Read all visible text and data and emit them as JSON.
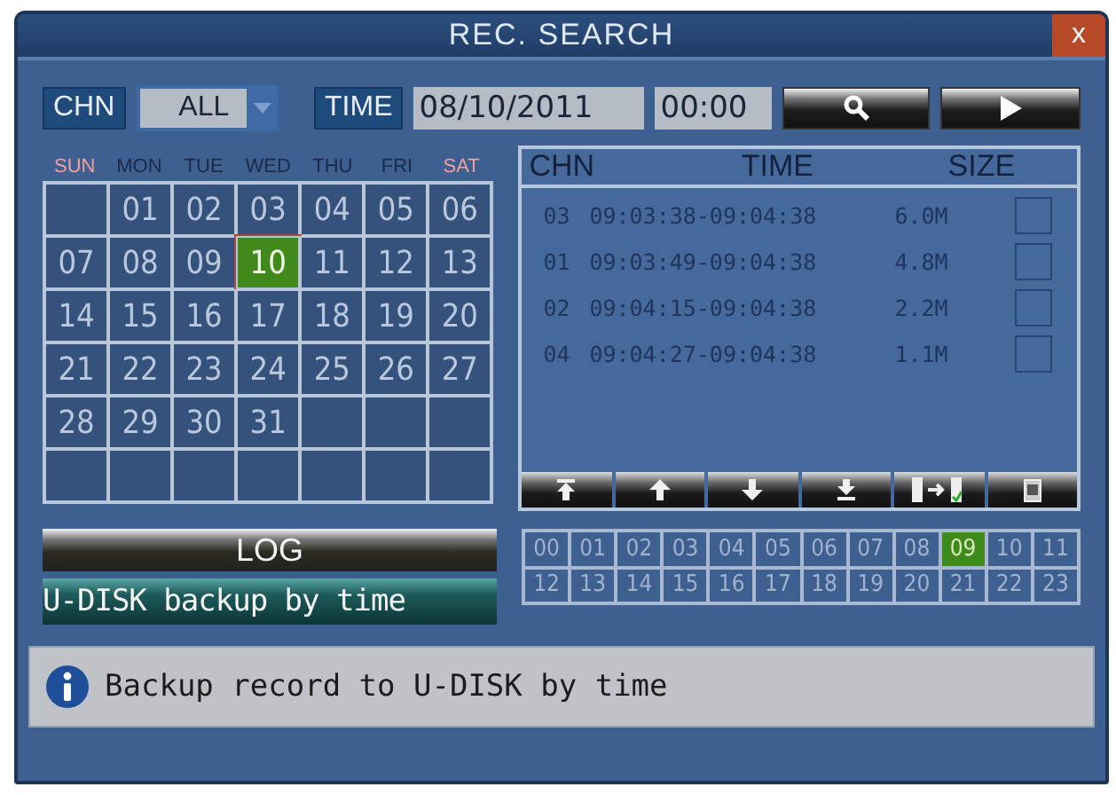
{
  "window": {
    "title": "REC. SEARCH",
    "close": "x"
  },
  "toolbar": {
    "channel_label": "CHN",
    "channel_value": "ALL",
    "time_label": "TIME",
    "date": "08/10/2011",
    "time": "00:00"
  },
  "calendar": {
    "weekdays": [
      {
        "label": "SUN",
        "weekend": true
      },
      {
        "label": "MON",
        "weekend": false
      },
      {
        "label": "TUE",
        "weekend": false
      },
      {
        "label": "WED",
        "weekend": false
      },
      {
        "label": "THU",
        "weekend": false
      },
      {
        "label": "FRI",
        "weekend": false
      },
      {
        "label": "SAT",
        "weekend": true
      }
    ],
    "weeks": [
      [
        {
          "kind": "blank"
        },
        {
          "kind": "day",
          "day": "01",
          "selected": false
        },
        {
          "kind": "day",
          "day": "02",
          "selected": false
        },
        {
          "kind": "day",
          "day": "03",
          "selected": false
        },
        {
          "kind": "day",
          "day": "04",
          "selected": false
        },
        {
          "kind": "day",
          "day": "05",
          "selected": false
        },
        {
          "kind": "day",
          "day": "06",
          "selected": false
        }
      ],
      [
        {
          "kind": "day",
          "day": "07",
          "selected": false
        },
        {
          "kind": "day",
          "day": "08",
          "selected": false
        },
        {
          "kind": "day",
          "day": "09",
          "selected": false
        },
        {
          "kind": "day",
          "day": "10",
          "selected": true
        },
        {
          "kind": "day",
          "day": "11",
          "selected": false
        },
        {
          "kind": "day",
          "day": "12",
          "selected": false
        },
        {
          "kind": "day",
          "day": "13",
          "selected": false
        }
      ],
      [
        {
          "kind": "day",
          "day": "14",
          "selected": false
        },
        {
          "kind": "day",
          "day": "15",
          "selected": false
        },
        {
          "kind": "day",
          "day": "16",
          "selected": false
        },
        {
          "kind": "day",
          "day": "17",
          "selected": false
        },
        {
          "kind": "day",
          "day": "18",
          "selected": false
        },
        {
          "kind": "day",
          "day": "19",
          "selected": false
        },
        {
          "kind": "day",
          "day": "20",
          "selected": false
        }
      ],
      [
        {
          "kind": "day",
          "day": "21",
          "selected": false
        },
        {
          "kind": "day",
          "day": "22",
          "selected": false
        },
        {
          "kind": "day",
          "day": "23",
          "selected": false
        },
        {
          "kind": "day",
          "day": "24",
          "selected": false
        },
        {
          "kind": "day",
          "day": "25",
          "selected": false
        },
        {
          "kind": "day",
          "day": "26",
          "selected": false
        },
        {
          "kind": "day",
          "day": "27",
          "selected": false
        }
      ],
      [
        {
          "kind": "day",
          "day": "28",
          "selected": false
        },
        {
          "kind": "day",
          "day": "29",
          "selected": false
        },
        {
          "kind": "day",
          "day": "30",
          "selected": false
        },
        {
          "kind": "day",
          "day": "31",
          "selected": false
        },
        {
          "kind": "blank"
        },
        {
          "kind": "blank"
        },
        {
          "kind": "blank"
        }
      ],
      [
        {
          "kind": "blank"
        },
        {
          "kind": "blank"
        },
        {
          "kind": "blank"
        },
        {
          "kind": "blank"
        },
        {
          "kind": "blank"
        },
        {
          "kind": "blank"
        },
        {
          "kind": "blank"
        }
      ]
    ]
  },
  "records": {
    "columns": [
      "CHN",
      "TIME",
      "SIZE"
    ],
    "rows": [
      {
        "chn": "03",
        "time": "09:03:38-09:04:38",
        "size": "6.0M",
        "checked": false
      },
      {
        "chn": "01",
        "time": "09:03:49-09:04:38",
        "size": "4.8M",
        "checked": false
      },
      {
        "chn": "02",
        "time": "09:04:15-09:04:38",
        "size": "2.2M",
        "checked": false
      },
      {
        "chn": "04",
        "time": "09:04:27-09:04:38",
        "size": "1.1M",
        "checked": false
      }
    ]
  },
  "log_button": "LOG",
  "backup_option": "U-DISK backup by time",
  "hours": [
    {
      "label": "00",
      "selected": false
    },
    {
      "label": "01",
      "selected": false
    },
    {
      "label": "02",
      "selected": false
    },
    {
      "label": "03",
      "selected": false
    },
    {
      "label": "04",
      "selected": false
    },
    {
      "label": "05",
      "selected": false
    },
    {
      "label": "06",
      "selected": false
    },
    {
      "label": "07",
      "selected": false
    },
    {
      "label": "08",
      "selected": false
    },
    {
      "label": "09",
      "selected": true
    },
    {
      "label": "10",
      "selected": false
    },
    {
      "label": "11",
      "selected": false
    },
    {
      "label": "12",
      "selected": false
    },
    {
      "label": "13",
      "selected": false
    },
    {
      "label": "14",
      "selected": false
    },
    {
      "label": "15",
      "selected": false
    },
    {
      "label": "16",
      "selected": false
    },
    {
      "label": "17",
      "selected": false
    },
    {
      "label": "18",
      "selected": false
    },
    {
      "label": "19",
      "selected": false
    },
    {
      "label": "20",
      "selected": false
    },
    {
      "label": "21",
      "selected": false
    },
    {
      "label": "22",
      "selected": false
    },
    {
      "label": "23",
      "selected": false
    }
  ],
  "status_bar": "Backup record to U-DISK by time"
}
